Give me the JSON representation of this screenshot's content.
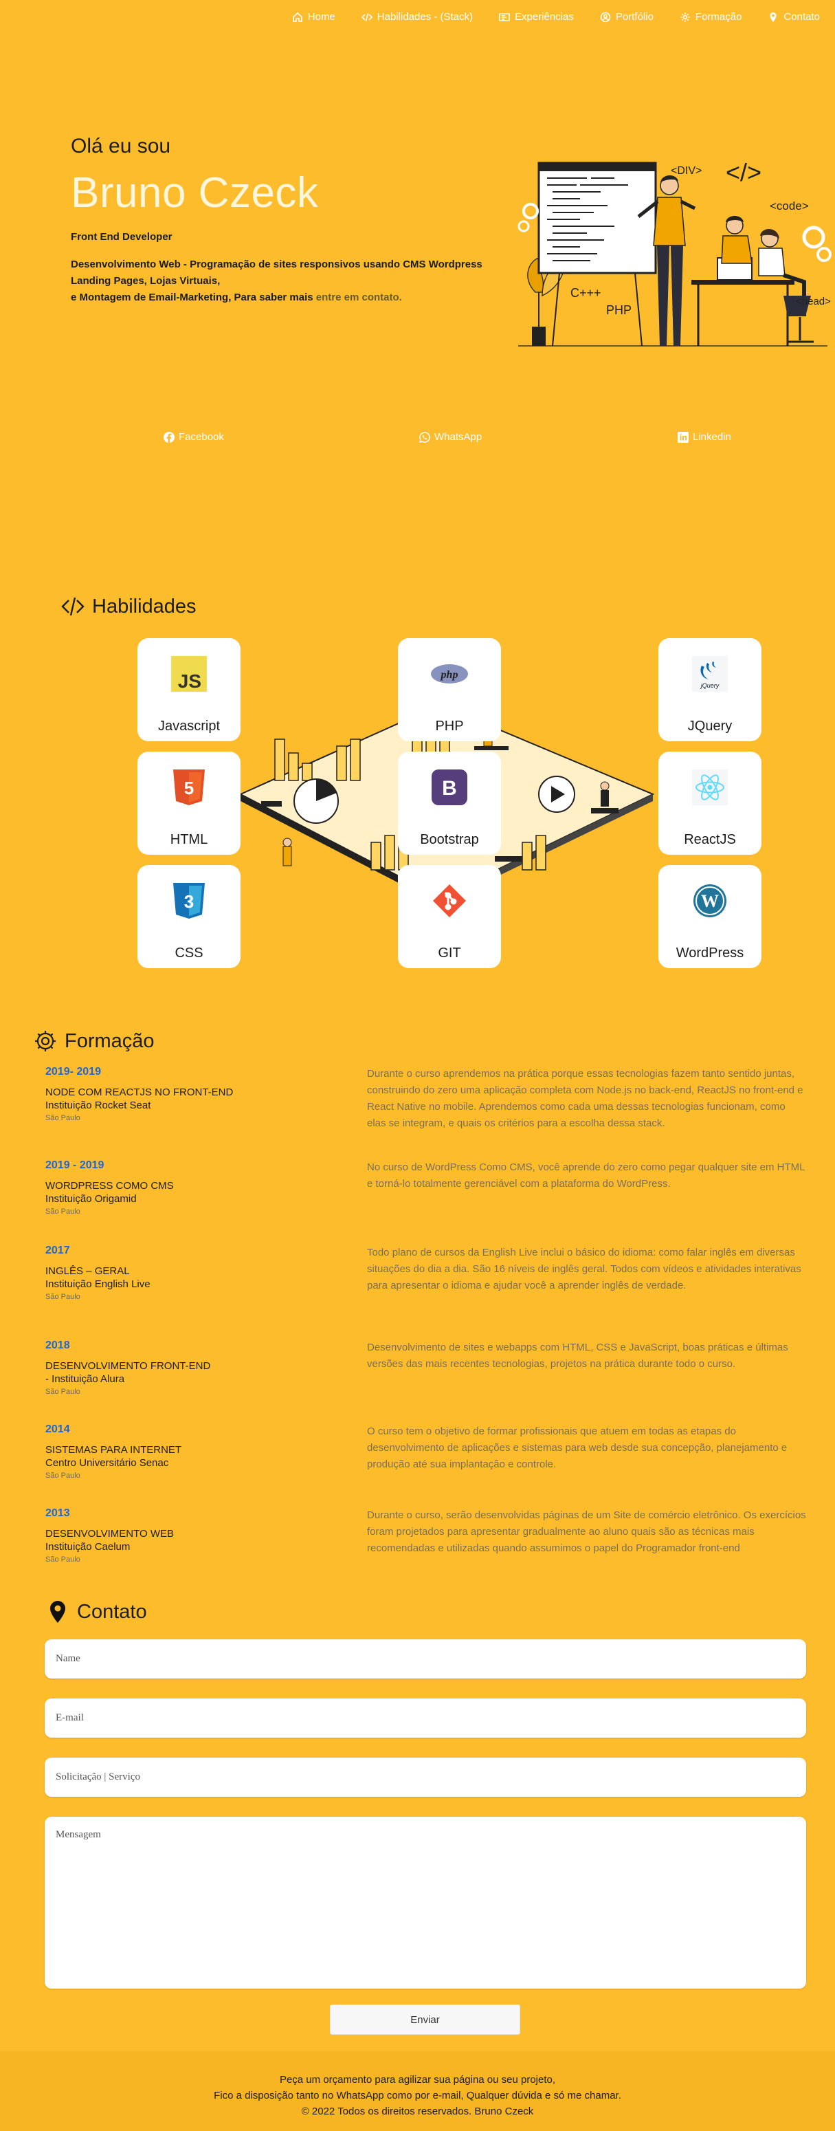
{
  "nav": {
    "items": [
      {
        "label": "Home",
        "icon": "home-icon"
      },
      {
        "label": "Habilidades - (Stack)",
        "icon": "code-icon"
      },
      {
        "label": "Experiências",
        "icon": "id-card-icon"
      },
      {
        "label": "Portfólio",
        "icon": "user-circle-icon"
      },
      {
        "label": "Formação",
        "icon": "gear-icon"
      },
      {
        "label": "Contato",
        "icon": "map-pin-icon"
      }
    ]
  },
  "hero": {
    "greeting": "Olá eu sou",
    "name": "Bruno Czeck",
    "role": "Front End Developer",
    "desc_line1": "Desenvolvimento Web - Programação de sites responsivos usando CMS Wordpress",
    "desc_line2": "Landing Pages, Lojas Virtuais,",
    "desc_line3": "e Montagem de Email-Marketing, Para saber mais ",
    "desc_link": "entre em contato.",
    "illustration_words": [
      "<DIV>",
      "</>",
      "<code>",
      "C+++",
      "PHP",
      "<head>"
    ]
  },
  "social": {
    "facebook": "Facebook",
    "whatsapp": "WhatsApp",
    "linkedin": "Linkedin"
  },
  "skills": {
    "title": "Habilidades",
    "cards": [
      {
        "label": "Javascript",
        "logo_text": "JS"
      },
      {
        "label": "PHP",
        "logo_text": "php"
      },
      {
        "label": "JQuery",
        "logo_text": "jQuery"
      },
      {
        "label": "HTML",
        "logo_text": "5"
      },
      {
        "label": "Bootstrap",
        "logo_text": "B"
      },
      {
        "label": "ReactJS",
        "logo_text": ""
      },
      {
        "label": "CSS",
        "logo_text": "3"
      },
      {
        "label": "GIT",
        "logo_text": ""
      },
      {
        "label": "WordPress",
        "logo_text": "W"
      }
    ]
  },
  "education": {
    "title": "Formação",
    "items": [
      {
        "year": "2019- 2019",
        "course": "NODE COM REACTJS NO FRONT-END",
        "institution": "Instituição Rocket Seat",
        "city": "São Paulo",
        "desc": "Durante o curso aprendemos na prática porque essas tecnologias fazem tanto sentido juntas, construindo do zero uma aplicação completa com Node.js no back-end, ReactJS no front-end e React Native no mobile. Aprendemos como cada uma dessas tecnologias funcionam, como elas se integram, e quais os critérios para a escolha dessa stack."
      },
      {
        "year": "2019 - 2019",
        "course": "WORDPRESS COMO CMS",
        "institution": "Instituição Origamid",
        "city": "São Paulo",
        "desc": "No curso de WordPress Como CMS, você aprende do zero como pegar qualquer site em HTML e torná-lo totalmente gerenciável com a plataforma do WordPress."
      },
      {
        "year": "2017",
        "course": "INGLÊS – GERAL",
        "institution": "Instituição English Live",
        "city": "São Paulo",
        "desc": "Todo plano de cursos da English Live inclui o básico do idioma: como falar inglês em diversas situações do dia a dia. São 16 níveis de inglês geral. Todos com vídeos e atividades interativas para apresentar o idioma e ajudar você a aprender inglês de verdade."
      },
      {
        "year": "2018",
        "course": "DESENVOLVIMENTO FRONT-END",
        "institution": "- Instituição Alura",
        "city": "São Paulo",
        "desc": "Desenvolvimento de sites e webapps com HTML, CSS e JavaScript, boas práticas e últimas versões das mais recentes tecnologias, projetos na prática durante todo o curso."
      },
      {
        "year": "2014",
        "course": "SISTEMAS PARA INTERNET",
        "institution": "Centro Universitário Senac",
        "city": "São Paulo",
        "desc": "O curso tem o objetivo de formar profissionais que atuem em todas as etapas do desenvolvimento de aplicações e sistemas para web desde sua concepção, planejamento e produção até sua implantação e controle."
      },
      {
        "year": "2013",
        "course": "DESENVOLVIMENTO WEB",
        "institution": "Instituição Caelum",
        "city": "São Paulo",
        "desc": "Durante o curso, serão desenvolvidas páginas de um Site de comércio eletrônico. Os exercícios foram projetados para apresentar gradualmente ao aluno quais são as técnicas mais recomendadas e utilizadas quando assumimos o papel do Programador front-end"
      }
    ]
  },
  "contact": {
    "title": "Contato",
    "name_placeholder": "Name",
    "email_placeholder": "E-mail",
    "request_placeholder": "Solicitação | Serviço",
    "message_placeholder": "Mensagem",
    "send_label": "Enviar"
  },
  "footer": {
    "line1": "Peça um orçamento para agilizar sua página ou seu projeto,",
    "line2": "Fico a disposição tanto no WhatsApp como por e-mail, Qualquer dúvida e só me chamar.",
    "line3": "© 2022 Todos os direitos reservados. Bruno Czeck"
  },
  "colors": {
    "background": "#fdbc2c",
    "footer": "#f7b423",
    "year_blue": "#1e66d6",
    "name_cream": "#fff6dc"
  }
}
